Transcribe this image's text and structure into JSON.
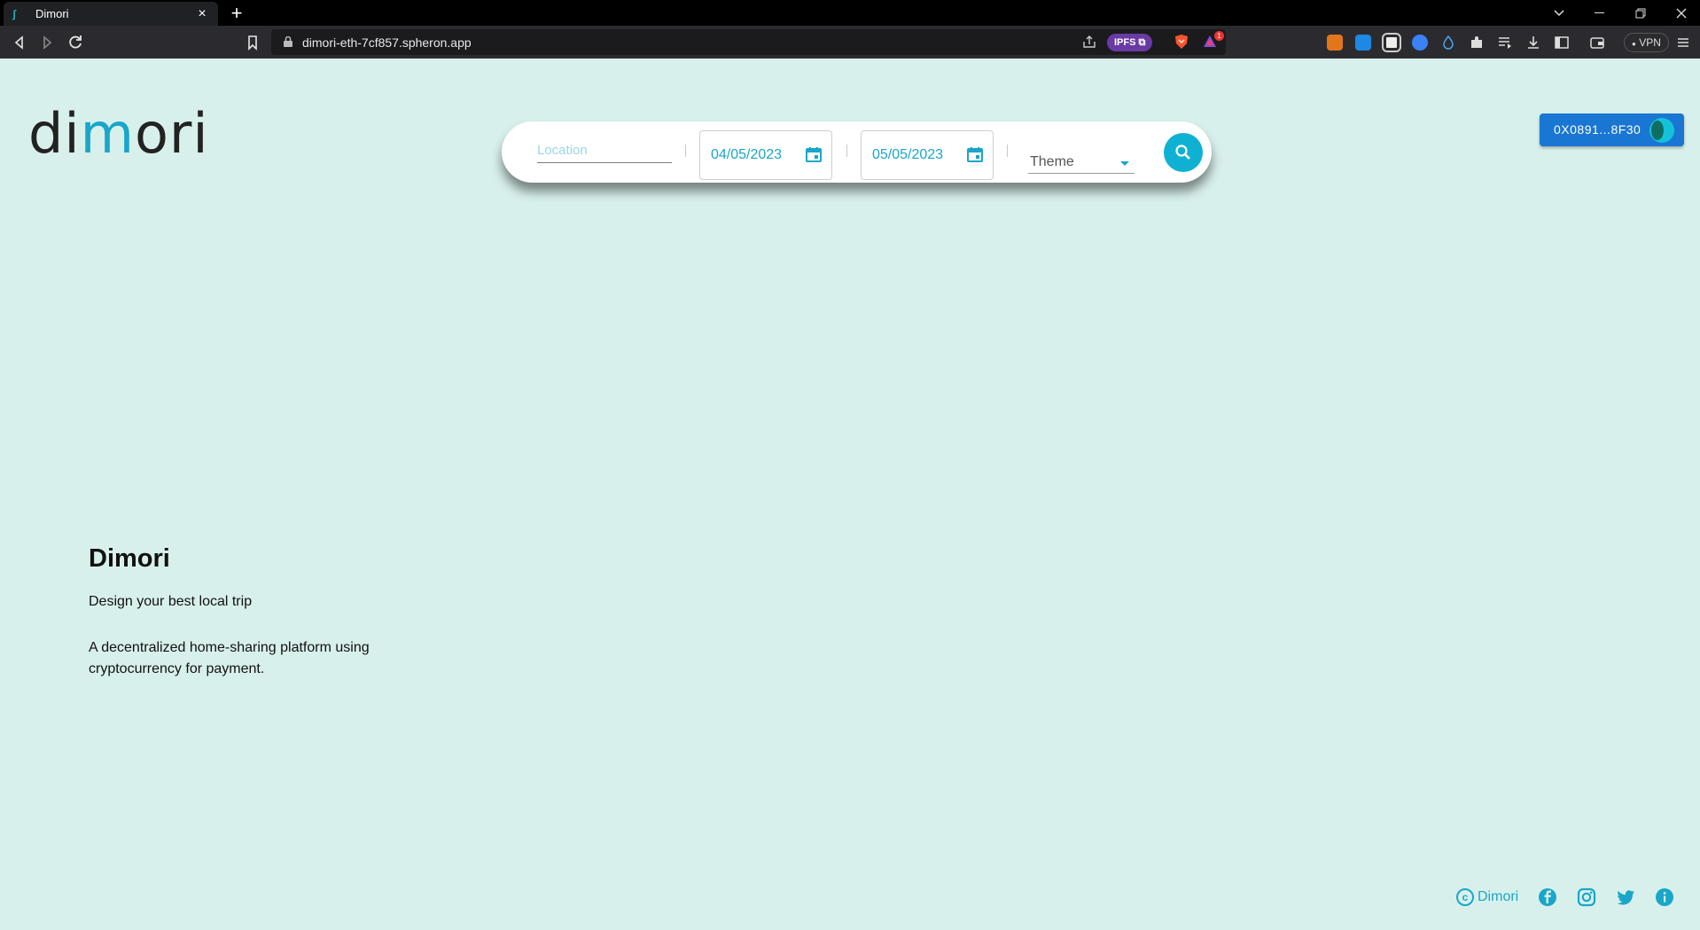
{
  "browser": {
    "tab_title": "Dimori",
    "tab_close": "×",
    "new_tab": "+",
    "url": "dimori-eth-7cf857.spheron.app",
    "ipfs_badge": "IPFS",
    "vpn_label": "VPN",
    "notification_count": "1"
  },
  "header": {
    "logo_pre": "di",
    "logo_mark": "m",
    "logo_post": "ori",
    "wallet_label": "0X0891...8F30"
  },
  "search": {
    "location_placeholder": "Location",
    "check_in": "04/05/2023",
    "check_out": "05/05/2023",
    "theme_label": "Theme"
  },
  "hero": {
    "title": "Dimori",
    "subtitle": "Design your best local trip",
    "description": "A decentralized home-sharing platform using cryptocurrency for payment."
  },
  "footer": {
    "copyright_symbol": "c",
    "copyright_name": "Dimori"
  },
  "colors": {
    "page_background": "#d8f0ec",
    "accent": "#1aa6c8",
    "wallet_button": "#1976d2",
    "search_button": "#0fb1d3"
  }
}
